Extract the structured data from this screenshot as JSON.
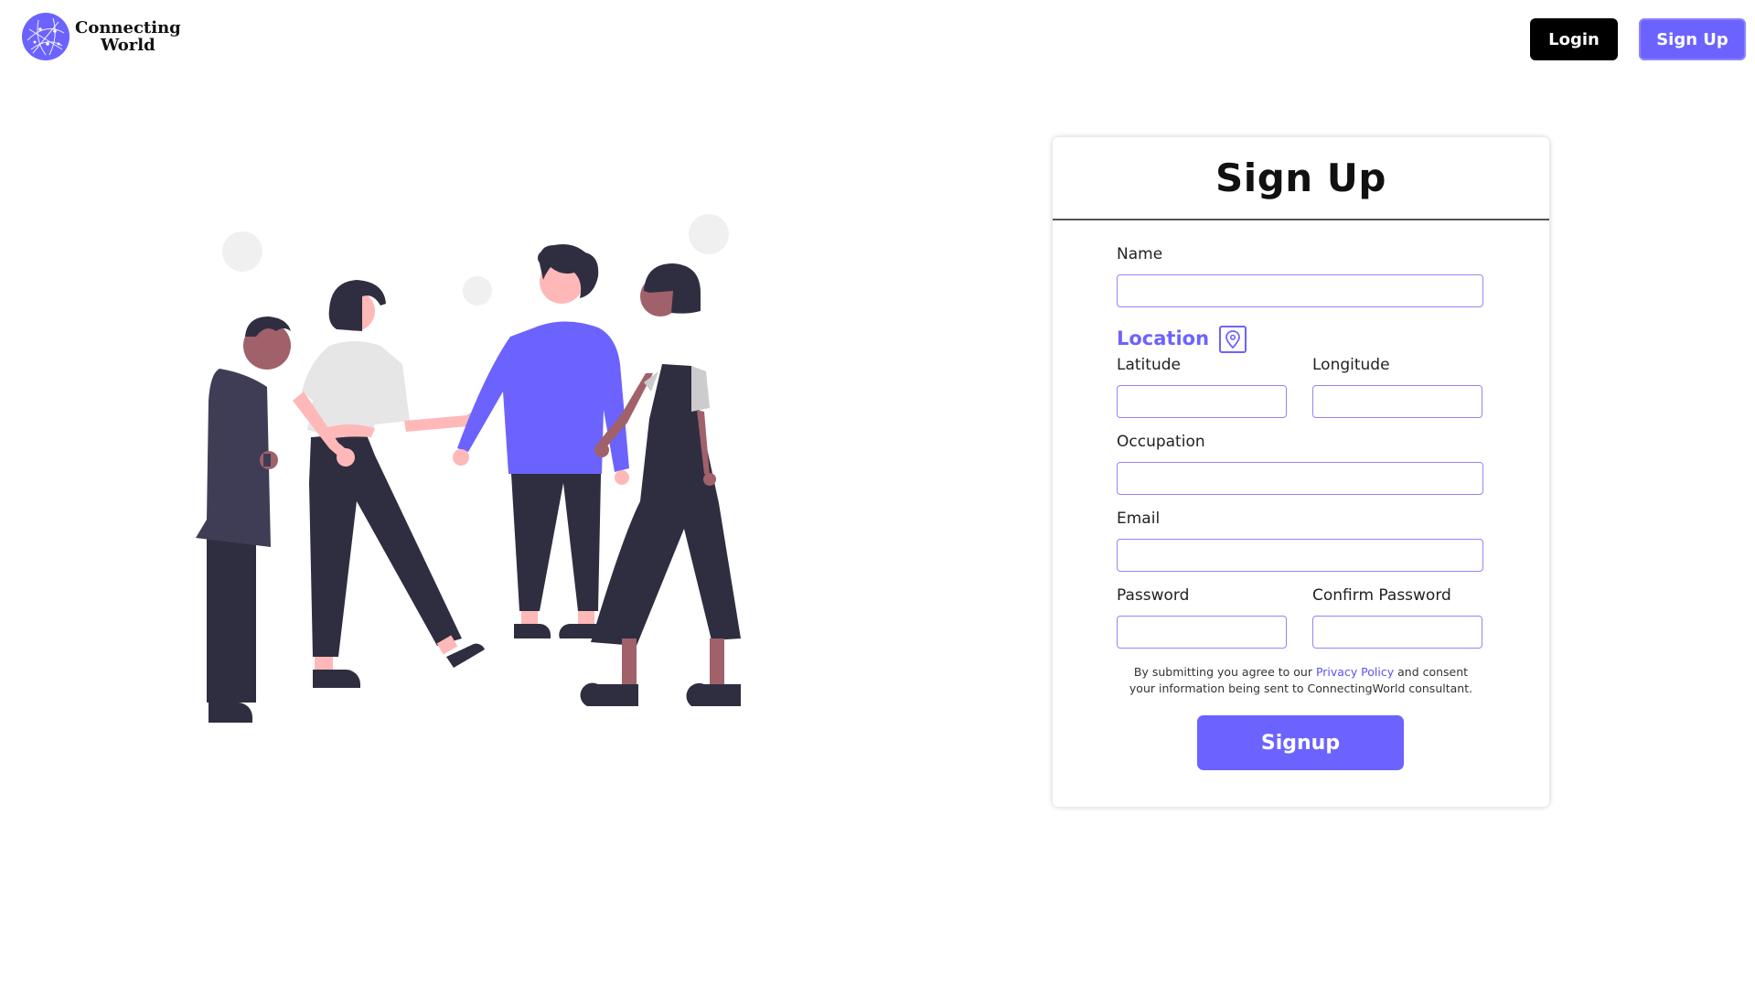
{
  "brand": {
    "line1": "Connecting",
    "line2": "World"
  },
  "nav": {
    "login_label": "Login",
    "signup_label": "Sign Up"
  },
  "form": {
    "title": "Sign Up",
    "name_label": "Name",
    "location_title": "Location",
    "latitude_label": "Latitude",
    "longitude_label": "Longitude",
    "occupation_label": "Occupation",
    "email_label": "Email",
    "password_label": "Password",
    "confirm_password_label": "Confirm Password",
    "consent_before": "By submitting you agree to our ",
    "consent_link": "Privacy Policy",
    "consent_after": " and consent",
    "consent_line2": "your information being sent to ConnectingWorld consultant.",
    "submit_label": "Signup"
  },
  "icons": {
    "logo": "globe-network-icon",
    "location": "map-pin-icon"
  },
  "colors": {
    "accent": "#6c63ff",
    "dark": "#2f2e41",
    "login_bg": "#000000"
  }
}
